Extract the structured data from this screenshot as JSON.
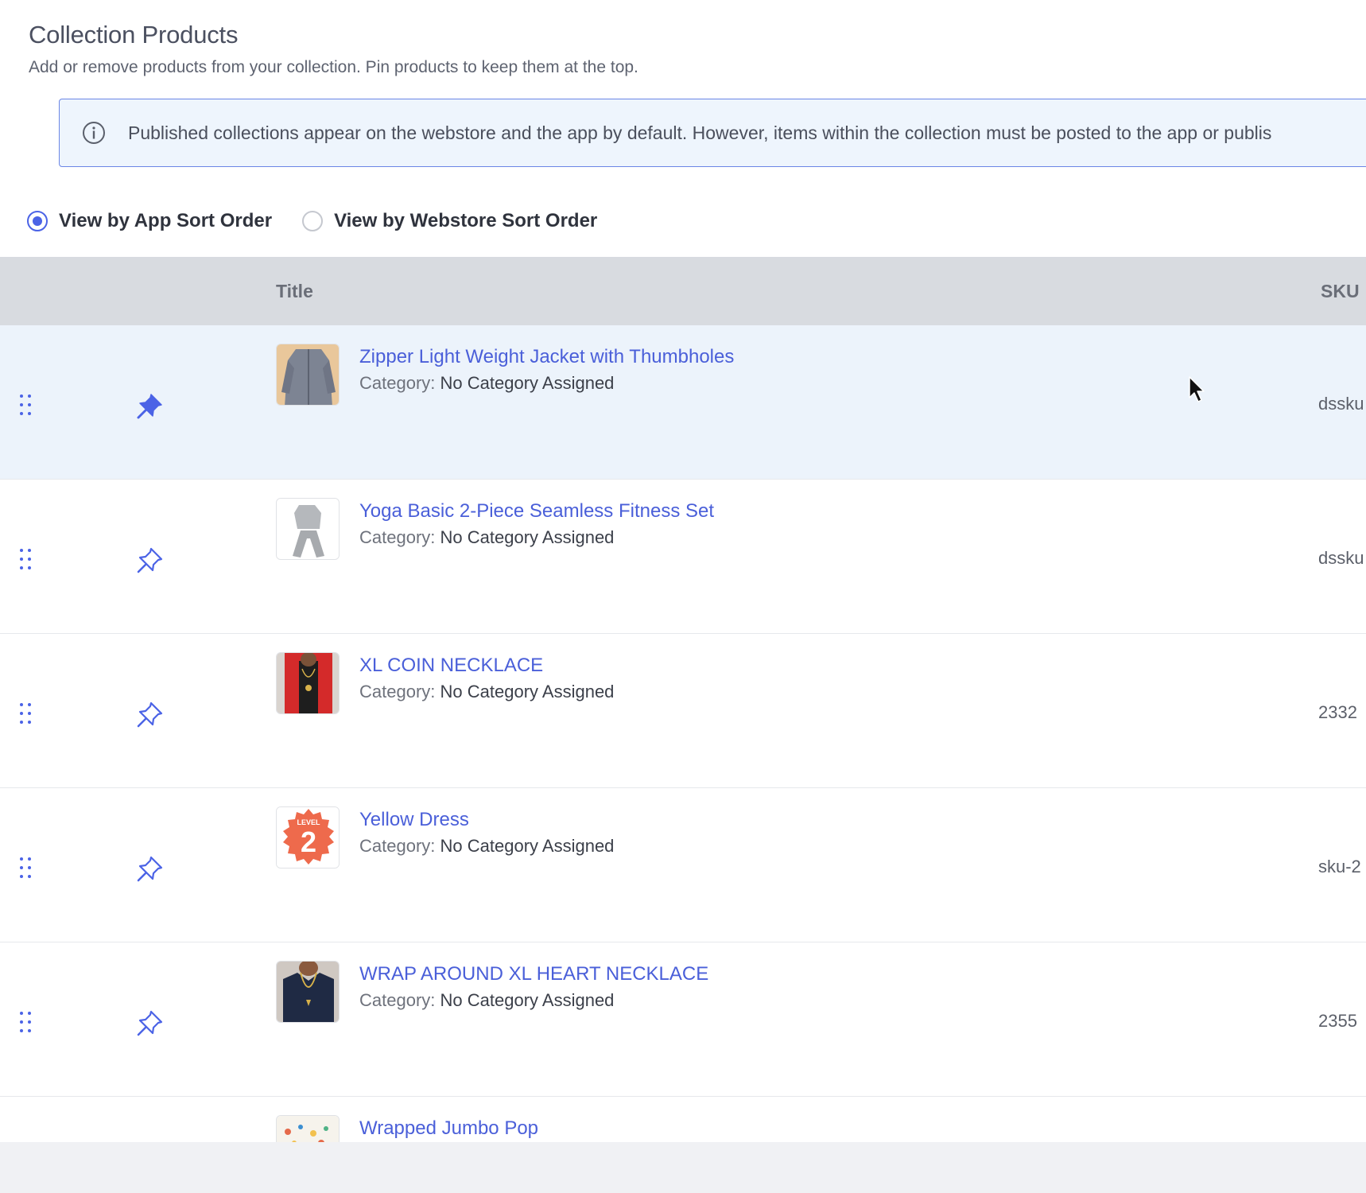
{
  "header": {
    "title": "Collection Products",
    "subtitle": "Add or remove products from your collection. Pin products to keep them at the top."
  },
  "banner": {
    "icon": "info-icon",
    "text": "Published collections appear on the webstore and the app by default. However, items within the collection must be posted to the app or publis"
  },
  "sort_options": [
    {
      "label": "View by App Sort Order",
      "checked": true
    },
    {
      "label": "View by Webstore Sort Order",
      "checked": false
    }
  ],
  "table": {
    "columns": {
      "title": "Title",
      "sku": "SKU"
    },
    "category_label": "Category:",
    "rows": [
      {
        "title": "Zipper Light Weight Jacket with Thumbholes",
        "category": "No Category Assigned",
        "sku": "dssku",
        "pinned": true,
        "thumb": "grey-jacket"
      },
      {
        "title": "Yoga Basic 2-Piece Seamless Fitness Set",
        "category": "No Category Assigned",
        "sku": "dssku",
        "pinned": false,
        "thumb": "grey-fitness-set"
      },
      {
        "title": "XL COIN NECKLACE",
        "category": "No Category Assigned",
        "sku": "2332",
        "pinned": false,
        "thumb": "red-jacket-necklace"
      },
      {
        "title": "Yellow Dress",
        "category": "No Category Assigned",
        "sku": "sku-2",
        "pinned": false,
        "thumb": "level-2-badge"
      },
      {
        "title": "WRAP AROUND XL HEART NECKLACE",
        "category": "No Category Assigned",
        "sku": "2355",
        "pinned": false,
        "thumb": "navy-top-necklace"
      },
      {
        "title": "Wrapped Jumbo Pop",
        "category": "",
        "sku": "",
        "pinned": false,
        "thumb": "confetti-pop"
      }
    ]
  },
  "colors": {
    "accent": "#4b63e6",
    "link": "#4a5fd9",
    "banner_bg": "#eef5fd",
    "banner_border": "#6b86e6",
    "header_bg": "#d8dbe0",
    "highlight_row": "#ecf3fb"
  }
}
